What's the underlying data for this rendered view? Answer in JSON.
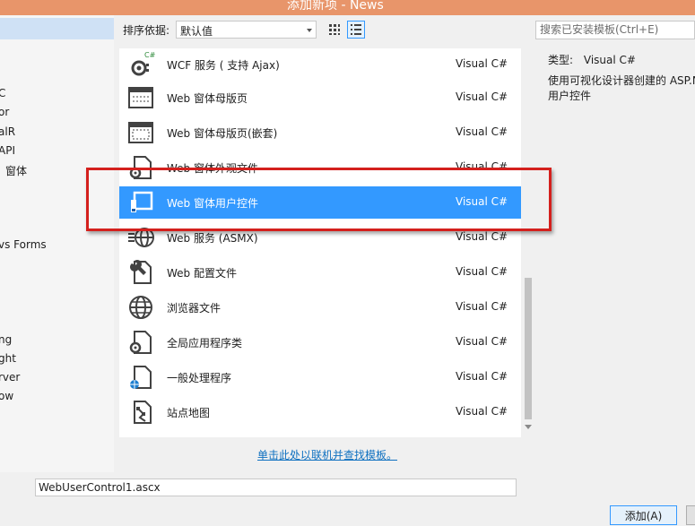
{
  "window": {
    "title": "添加新项 - News",
    "title_bar_color": "#e8956a"
  },
  "left_panel": {
    "items": [
      {
        "label": "C"
      },
      {
        "label": "or"
      },
      {
        "label": "alR"
      },
      {
        "label": " API"
      },
      {
        "label": "窗体"
      },
      {
        "label": "vs Forms"
      },
      {
        "label": "ng"
      },
      {
        "label": "ght"
      },
      {
        "label": "rver"
      },
      {
        "label": "ow"
      }
    ]
  },
  "sort": {
    "label": "排序依据:",
    "value": "默认值"
  },
  "view_buttons": {
    "medium_icons": "grid-icon",
    "list": "list-icon"
  },
  "search": {
    "placeholder": "搜索已安装模板(Ctrl+E)"
  },
  "templates": [
    {
      "name": "WCF 服务 ( 支持 Ajax)",
      "lang": "Visual C#",
      "icon": "wcf-service-icon",
      "selected": false
    },
    {
      "name": "Web 窗体母版页",
      "lang": "Visual C#",
      "icon": "web-master-page-icon",
      "selected": false
    },
    {
      "name": "Web 窗体母版页(嵌套)",
      "lang": "Visual C#",
      "icon": "web-nested-master-page-icon",
      "selected": false
    },
    {
      "name": "Web 窗体外观文件",
      "lang": "Visual C#",
      "icon": "web-skin-file-icon",
      "selected": false
    },
    {
      "name": "Web 窗体用户控件",
      "lang": "Visual C#",
      "icon": "web-user-control-icon",
      "selected": true
    },
    {
      "name": "Web 服务 (ASMX)",
      "lang": "Visual C#",
      "icon": "web-service-asmx-icon",
      "selected": false
    },
    {
      "name": "Web 配置文件",
      "lang": "Visual C#",
      "icon": "web-config-icon",
      "selected": false
    },
    {
      "name": "浏览器文件",
      "lang": "Visual C#",
      "icon": "browser-file-icon",
      "selected": false
    },
    {
      "name": "全局应用程序类",
      "lang": "Visual C#",
      "icon": "global-app-class-icon",
      "selected": false
    },
    {
      "name": "一般处理程序",
      "lang": "Visual C#",
      "icon": "generic-handler-icon",
      "selected": false
    },
    {
      "name": "站点地图",
      "lang": "Visual C#",
      "icon": "sitemap-icon",
      "selected": false
    }
  ],
  "online_link": "单击此处以联机并查找模板。",
  "details": {
    "type_label": "类型:",
    "type_value": "Visual C#",
    "description": "使用可视化设计器创建的 ASP.NET 用户控件"
  },
  "name_field": {
    "value": "WebUserControl1.ascx"
  },
  "buttons": {
    "add": "添加(A)"
  },
  "colors": {
    "selection": "#3399ff",
    "highlight_box": "#d4201d",
    "link": "#0e70c0"
  }
}
